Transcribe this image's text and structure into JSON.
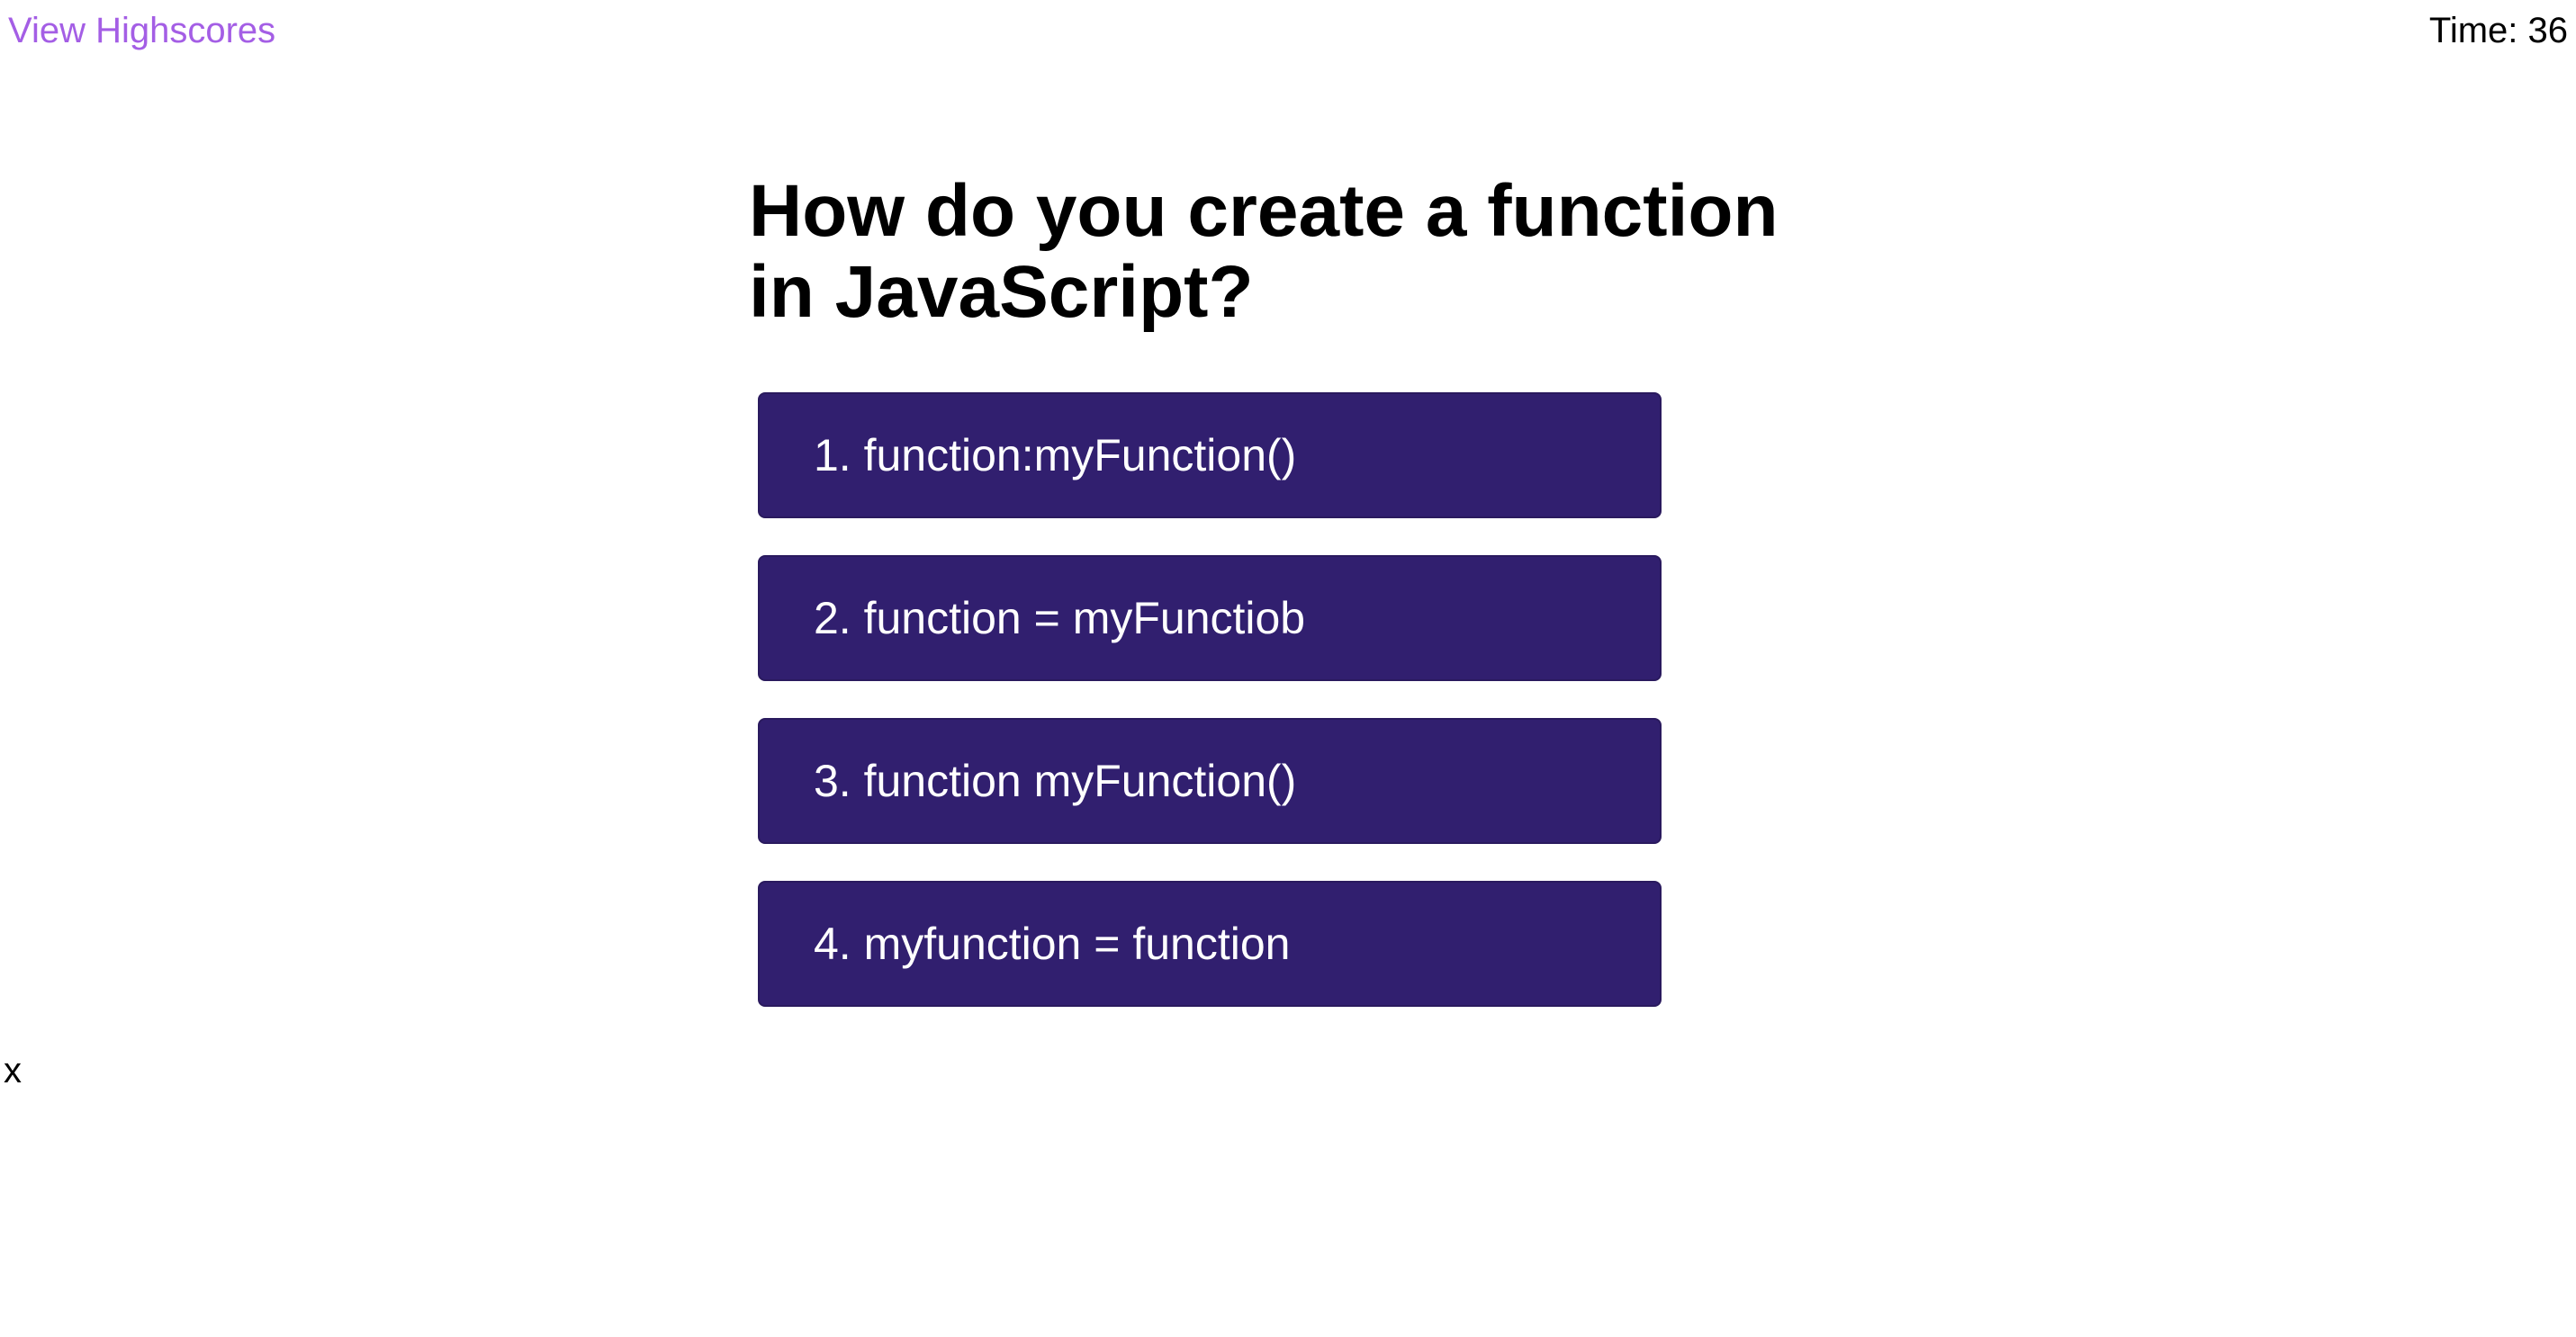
{
  "header": {
    "highscores_label": "View Highscores",
    "timer_text": "Time: 36",
    "link_color": "#a45ee5"
  },
  "quiz": {
    "question": "How do you create a function in JavaScript?",
    "choices": [
      {
        "label": "1. function:myFunction()"
      },
      {
        "label": "2. function = myFunctiob"
      },
      {
        "label": "3. function myFunction()"
      },
      {
        "label": "4. myfunction = function"
      }
    ],
    "choice_color": "#311f6f"
  },
  "feedback": {
    "text": "x"
  }
}
